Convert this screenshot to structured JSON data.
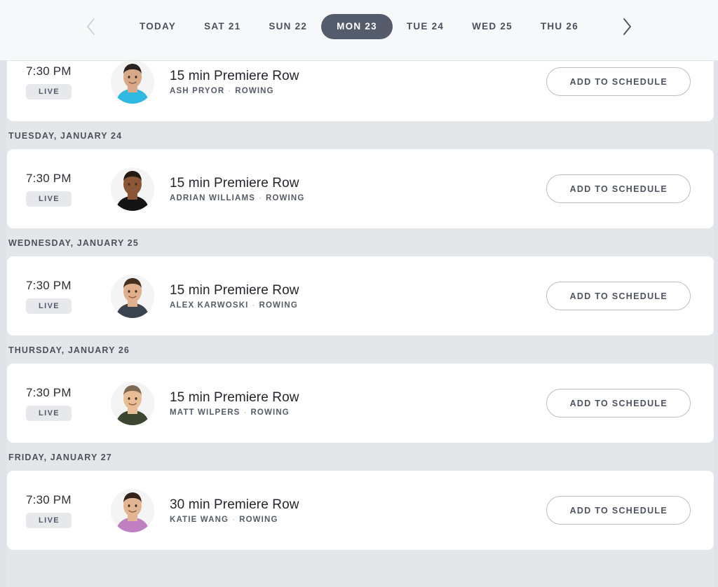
{
  "date_nav": {
    "prev_icon": "chevron-left-icon",
    "next_icon": "chevron-right-icon",
    "active_day": "MON 23",
    "days": [
      {
        "label": "TODAY",
        "active": false
      },
      {
        "label": "SAT 21",
        "active": false
      },
      {
        "label": "SUN 22",
        "active": false
      },
      {
        "label": "MON 23",
        "active": true
      },
      {
        "label": "TUE 24",
        "active": false
      },
      {
        "label": "WED 25",
        "active": false
      },
      {
        "label": "THU 26",
        "active": false
      }
    ]
  },
  "colors": {
    "active_tab_bg": "#545b6a",
    "page_bg": "#e4e7ea",
    "header_bg": "#f7f8f9",
    "card_bg": "#ffffff",
    "live_badge_bg": "#e6e8eb",
    "text_primary": "#23262c",
    "text_secondary": "#565c66"
  },
  "button_label": "ADD TO SCHEDULE",
  "live_label": "LIVE",
  "groups": [
    {
      "header": null,
      "clipped": true,
      "classes": [
        {
          "time": "7:30 PM",
          "status": "LIVE",
          "title": "15 min Premiere Row",
          "instructor": "ASH PRYOR",
          "discipline": "ROWING",
          "avatar": "ash-pryor-avatar",
          "skin": "#d8a888",
          "hair": "#2a2320",
          "shirt": "#2fb8e0",
          "action": "ADD TO SCHEDULE"
        }
      ]
    },
    {
      "header": "TUESDAY, JANUARY 24",
      "clipped": false,
      "classes": [
        {
          "time": "7:30 PM",
          "status": "LIVE",
          "title": "15 min Premiere Row",
          "instructor": "ADRIAN WILLIAMS",
          "discipline": "ROWING",
          "avatar": "adrian-williams-avatar",
          "skin": "#8a5636",
          "hair": "#241a14",
          "shirt": "#141414",
          "action": "ADD TO SCHEDULE"
        }
      ]
    },
    {
      "header": "WEDNESDAY, JANUARY 25",
      "clipped": false,
      "classes": [
        {
          "time": "7:30 PM",
          "status": "LIVE",
          "title": "15 min Premiere Row",
          "instructor": "ALEX KARWOSKI",
          "discipline": "ROWING",
          "avatar": "alex-karwoski-avatar",
          "skin": "#e0b08c",
          "hair": "#45301f",
          "shirt": "#3b4350",
          "action": "ADD TO SCHEDULE"
        }
      ]
    },
    {
      "header": "THURSDAY, JANUARY 26",
      "clipped": false,
      "classes": [
        {
          "time": "7:30 PM",
          "status": "LIVE",
          "title": "15 min Premiere Row",
          "instructor": "MATT WILPERS",
          "discipline": "ROWING",
          "avatar": "matt-wilpers-avatar",
          "skin": "#e8bd96",
          "hair": "#7d6a52",
          "shirt": "#3c4630",
          "action": "ADD TO SCHEDULE"
        }
      ]
    },
    {
      "header": "FRIDAY, JANUARY 27",
      "clipped": false,
      "classes": [
        {
          "time": "7:30 PM",
          "status": "LIVE",
          "title": "30 min Premiere Row",
          "instructor": "KATIE WANG",
          "discipline": "ROWING",
          "avatar": "katie-wang-avatar",
          "skin": "#e3b492",
          "hair": "#33221a",
          "shirt": "#c07fc0",
          "action": "ADD TO SCHEDULE"
        }
      ]
    }
  ]
}
